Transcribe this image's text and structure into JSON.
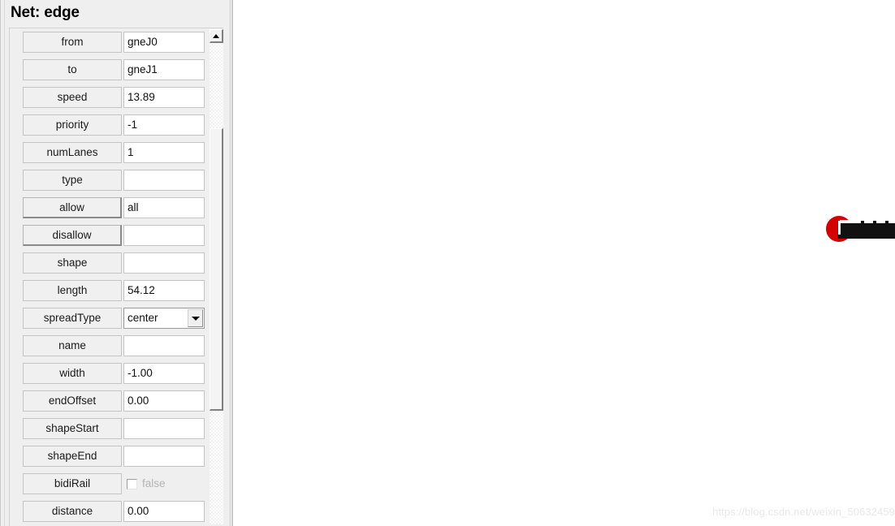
{
  "inspector": {
    "title": "Net: edge",
    "scrollbar": {
      "up_arrow_icon": "triangle-up-icon"
    },
    "attributes": [
      {
        "label": "from",
        "value": "gneJ0",
        "kind": "text",
        "raised": false
      },
      {
        "label": "to",
        "value": "gneJ1",
        "kind": "text",
        "raised": false
      },
      {
        "label": "speed",
        "value": "13.89",
        "kind": "text",
        "raised": false
      },
      {
        "label": "priority",
        "value": "-1",
        "kind": "text",
        "raised": false
      },
      {
        "label": "numLanes",
        "value": "1",
        "kind": "text",
        "raised": false
      },
      {
        "label": "type",
        "value": "",
        "kind": "text",
        "raised": false
      },
      {
        "label": "allow",
        "value": "all",
        "kind": "text",
        "raised": true
      },
      {
        "label": "disallow",
        "value": "",
        "kind": "text",
        "raised": true
      },
      {
        "label": "shape",
        "value": "",
        "kind": "text",
        "raised": false
      },
      {
        "label": "length",
        "value": "54.12",
        "kind": "text",
        "raised": false
      },
      {
        "label": "spreadType",
        "value": "center",
        "kind": "combo",
        "raised": false
      },
      {
        "label": "name",
        "value": "",
        "kind": "text",
        "raised": false
      },
      {
        "label": "width",
        "value": "-1.00",
        "kind": "text",
        "raised": false
      },
      {
        "label": "endOffset",
        "value": "0.00",
        "kind": "text",
        "raised": false
      },
      {
        "label": "shapeStart",
        "value": "",
        "kind": "text",
        "raised": false
      },
      {
        "label": "shapeEnd",
        "value": "",
        "kind": "text",
        "raised": false
      },
      {
        "label": "bidiRail",
        "value": "false",
        "kind": "checkbox",
        "raised": false,
        "checked": false
      },
      {
        "label": "distance",
        "value": "0.00",
        "kind": "text",
        "raised": false
      }
    ]
  },
  "canvas": {
    "junction_color": "#d40000",
    "edge_color": "#111111",
    "watermark": "https://blog.csdn.net/weixin_50632459"
  }
}
